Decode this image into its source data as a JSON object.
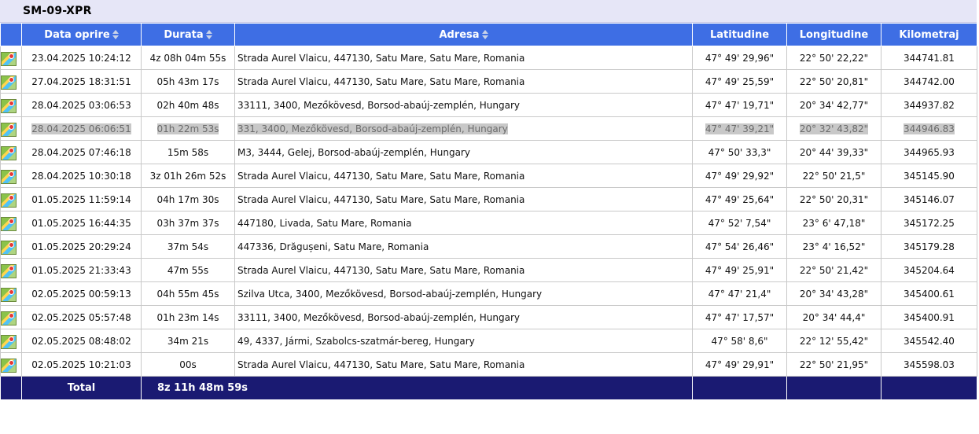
{
  "vehicle": {
    "plate": "SM-09-XPR"
  },
  "headers": {
    "date": "Data oprire",
    "duration": "Durata",
    "address": "Adresa",
    "lat": "Latitudine",
    "lon": "Longitudine",
    "km": "Kilometraj"
  },
  "rows": [
    {
      "date": "23.04.2025 10:24:12",
      "duration": "4z 08h 04m 55s",
      "address": "Strada Aurel Vlaicu,  447130, Satu Mare, Satu Mare, Romania",
      "lat": "47° 49' 29,96\"",
      "lon": "22° 50' 22,22\"",
      "km": "344741.81"
    },
    {
      "date": "27.04.2025 18:31:51",
      "duration": "05h 43m 17s",
      "address": "Strada Aurel Vlaicu,  447130, Satu Mare, Satu Mare, Romania",
      "lat": "47° 49' 25,59\"",
      "lon": "22° 50' 20,81\"",
      "km": "344742.00"
    },
    {
      "date": "28.04.2025 03:06:53",
      "duration": "02h 40m 48s",
      "address": "33111,  3400, Mezőkövesd, Borsod-abaúj-zemplén, Hungary",
      "lat": "47° 47' 19,71\"",
      "lon": "20° 34' 42,77\"",
      "km": "344937.82"
    },
    {
      "date": "28.04.2025 06:06:51",
      "duration": "01h 22m 53s",
      "address": "331,  3400, Mezőkövesd, Borsod-abaúj-zemplén, Hungary",
      "lat": "47° 47' 39,21\"",
      "lon": "20° 32' 43,82\"",
      "km": "344946.83",
      "highlight": true
    },
    {
      "date": "28.04.2025 07:46:18",
      "duration": "15m 58s",
      "address": "M3,  3444, Gelej, Borsod-abaúj-zemplén, Hungary",
      "lat": "47° 50' 33,3\"",
      "lon": "20° 44' 39,33\"",
      "km": "344965.93"
    },
    {
      "date": "28.04.2025 10:30:18",
      "duration": "3z 01h 26m 52s",
      "address": "Strada Aurel Vlaicu,  447130, Satu Mare, Satu Mare, Romania",
      "lat": "47° 49' 29,92\"",
      "lon": "22° 50' 21,5\"",
      "km": "345145.90"
    },
    {
      "date": "01.05.2025 11:59:14",
      "duration": "04h 17m 30s",
      "address": "Strada Aurel Vlaicu,  447130, Satu Mare, Satu Mare, Romania",
      "lat": "47° 49' 25,64\"",
      "lon": "22° 50' 20,31\"",
      "km": "345146.07"
    },
    {
      "date": "01.05.2025 16:44:35",
      "duration": "03h 37m 37s",
      "address": "447180, Livada, Satu Mare, Romania",
      "lat": "47° 52' 7,54\"",
      "lon": "23° 6' 47,18\"",
      "km": "345172.25"
    },
    {
      "date": "01.05.2025 20:29:24",
      "duration": "37m 54s",
      "address": "447336, Drăgușeni, Satu Mare, Romania",
      "lat": "47° 54' 26,46\"",
      "lon": "23° 4' 16,52\"",
      "km": "345179.28"
    },
    {
      "date": "01.05.2025 21:33:43",
      "duration": "47m 55s",
      "address": "Strada Aurel Vlaicu,  447130, Satu Mare, Satu Mare, Romania",
      "lat": "47° 49' 25,91\"",
      "lon": "22° 50' 21,42\"",
      "km": "345204.64"
    },
    {
      "date": "02.05.2025 00:59:13",
      "duration": "04h 55m 45s",
      "address": "Szilva Utca,  3400, Mezőkövesd, Borsod-abaúj-zemplén, Hungary",
      "lat": "47° 47' 21,4\"",
      "lon": "20° 34' 43,28\"",
      "km": "345400.61"
    },
    {
      "date": "02.05.2025 05:57:48",
      "duration": "01h 23m 14s",
      "address": "33111,  3400, Mezőkövesd, Borsod-abaúj-zemplén, Hungary",
      "lat": "47° 47' 17,57\"",
      "lon": "20° 34' 44,4\"",
      "km": "345400.91"
    },
    {
      "date": "02.05.2025 08:48:02",
      "duration": "34m 21s",
      "address": "49,  4337, Jármi, Szabolcs-szatmár-bereg, Hungary",
      "lat": "47° 58' 8,6\"",
      "lon": "22° 12' 55,42\"",
      "km": "345542.40"
    },
    {
      "date": "02.05.2025 10:21:03",
      "duration": "00s",
      "address": "Strada Aurel Vlaicu,  447130, Satu Mare, Satu Mare, Romania",
      "lat": "47° 49' 29,91\"",
      "lon": "22° 50' 21,95\"",
      "km": "345598.03"
    }
  ],
  "footer": {
    "label": "Total",
    "total_duration": "8z 11h 48m 59s"
  },
  "colors": {
    "header_bg": "#3e6ee4",
    "footer_bg": "#1a1a72",
    "title_bg": "#e6e6f7",
    "highlight": "#c8c8c8"
  },
  "icons": {
    "row_icon": "map-icon",
    "sort_icon": "sort-arrows-icon"
  }
}
